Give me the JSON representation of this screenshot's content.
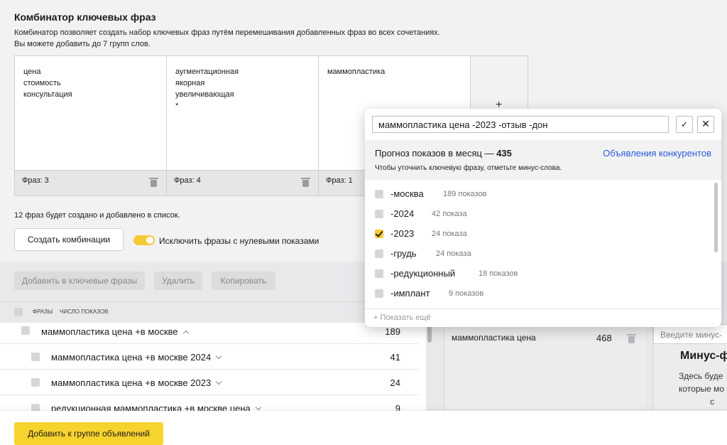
{
  "combinator": {
    "title": "Комбинатор ключевых фраз",
    "desc_line1": "Комбинатор позволяет создать набор ключевых фраз путём перемешивания добавленных фраз во всех сочетаниях.",
    "desc_line2": "Вы можете добавить до 7 групп слов.",
    "groups": [
      {
        "words": "цена\nстоимость\nконсультация",
        "count_label": "Фраз: 3"
      },
      {
        "words": "аугментационная\nякорная\nувеличивающая\n*",
        "count_label": "Фраз: 4"
      },
      {
        "words": "маммопластика",
        "count_label": "Фраз: 1"
      }
    ],
    "add_group_icon": "+",
    "status": "12 фраз будет создано и добавлено в список.",
    "create_button": "Создать комбинации",
    "exclude_toggle_label": "Исключить фразы с нулевыми показами",
    "exclude_toggle_on": true
  },
  "toolbar": {
    "add_label": "Добавить в ключевые фразы",
    "delete_label": "Удалить",
    "copy_label": "Копировать"
  },
  "table": {
    "col_phrases": "Фразы",
    "col_impressions": "Число показов",
    "rows": [
      {
        "phrase": "маммопластика цена +в москве",
        "count": "189"
      },
      {
        "phrase": "маммопластика цена +в москве 2024",
        "count": "41"
      },
      {
        "phrase": "маммопластика цена +в москве 2023",
        "count": "24"
      },
      {
        "phrase": "редукционная маммопластика +в москве цена",
        "count": "9"
      }
    ]
  },
  "selected": {
    "phrase": "маммопластика цена",
    "count": "468"
  },
  "minus": {
    "input_placeholder": "Введите минус-",
    "heading": "Минус-ф",
    "text_line1": "Здесь буде",
    "text_line2": "которые мо",
    "text_line3": "с"
  },
  "bottom": {
    "add_to_group_button": "Добавить к группе объявлений"
  },
  "popup": {
    "query": "маммопластика цена -2023 -отзыв -дон",
    "ok_icon": "✓",
    "close_icon": "✕",
    "forecast_label": "Прогноз показов в месяц —",
    "forecast_value": "435",
    "hint": "Чтобы уточнить ключевую фразу, отметьте минус-слова.",
    "competitors_link": "Объявления конкурентов",
    "minus_words": [
      {
        "word": "-москва",
        "count": "189 показов",
        "checked": false
      },
      {
        "word": "-2024",
        "count": "42 показа",
        "checked": false
      },
      {
        "word": "-2023",
        "count": "24 показа",
        "checked": true
      },
      {
        "word": "-грудь",
        "count": "24 показа",
        "checked": false
      },
      {
        "word": "-редукционный",
        "count": "18 показов",
        "checked": false
      },
      {
        "word": "-имплант",
        "count": "9 показов",
        "checked": false
      }
    ],
    "show_more": "Показать ещё",
    "show_more_icon": "+"
  },
  "colors": {
    "accent_yellow": "#f7d32d",
    "link_blue": "#2a5bd7"
  }
}
